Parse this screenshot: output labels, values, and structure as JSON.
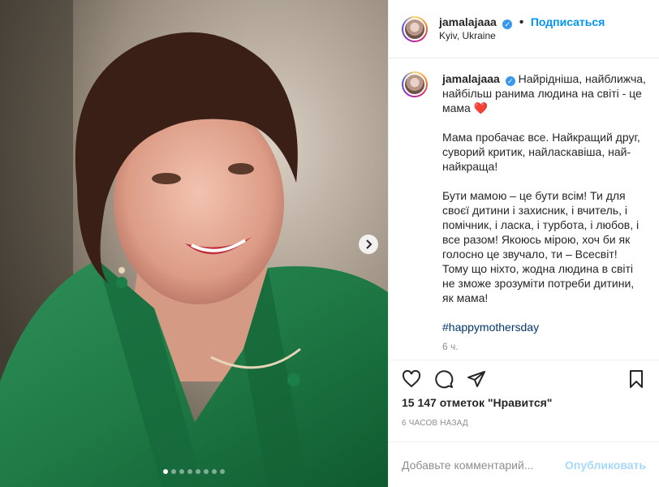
{
  "header": {
    "username": "jamalajaaa",
    "follow_label": "Подписаться",
    "location": "Kyiv, Ukraine",
    "verified_icon": "verified-badge-icon"
  },
  "caption": {
    "username": "jamalajaaa",
    "paragraph1": "Найрідніша, найближча, найбільш ранима людина на світі - це мама",
    "heart": "❤️",
    "paragraph2": "Мама пробачає все. Найкращий друг, суворий критик, найласкавіша, най-найкраща!",
    "paragraph3": "Бути мамою – це бути всім! Ти для своєї дитини і захисник, і вчитель, і помічник, і ласка, і турбота, і любов, і все разом! Якоюсь мірою, хоч би як голосно це звучало, ти – Всесвіт! Тому що ніхто, жодна людина в світі не зможе зрозуміти потреби дитини, як мама!",
    "hashtag": "#happymothersday",
    "time": "6 ч."
  },
  "actions": {
    "likes": "15 147 отметок \"Нравится\"",
    "posted": "6 ЧАСОВ НАЗАД"
  },
  "comment_box": {
    "placeholder": "Добавьте комментарий...",
    "publish_label": "Опубликовать"
  },
  "carousel": {
    "total": 8,
    "current": 1
  },
  "colors": {
    "accent": "#0095f6",
    "verified": "#3897f0",
    "heart": "#e0245e"
  }
}
